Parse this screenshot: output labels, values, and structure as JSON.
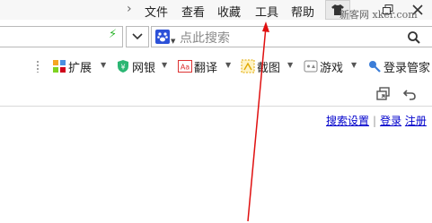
{
  "menubar": {
    "items": [
      {
        "label": "文件"
      },
      {
        "label": "查看"
      },
      {
        "label": "收藏"
      },
      {
        "label": "工具"
      },
      {
        "label": "帮助"
      }
    ],
    "watermark": "新客网 xker.com"
  },
  "search": {
    "placeholder": "点此搜索",
    "engine_icon": "baidu-paw-icon"
  },
  "toolbar": {
    "items": [
      {
        "label": "扩展",
        "icon": "extensions-icon"
      },
      {
        "label": "网银",
        "icon": "shield-bank-icon"
      },
      {
        "label": "翻译",
        "icon": "translate-icon"
      },
      {
        "label": "截图",
        "icon": "screenshot-icon"
      },
      {
        "label": "游戏",
        "icon": "game-icon"
      },
      {
        "label": "登录管家",
        "icon": "login-key-icon"
      }
    ]
  },
  "page": {
    "links": {
      "search_settings": "搜索设置",
      "login": "登录",
      "register": "注册"
    }
  },
  "colors": {
    "accent_arrow": "#e01010",
    "link": "#0000cc",
    "bolt": "#2bb32b"
  }
}
